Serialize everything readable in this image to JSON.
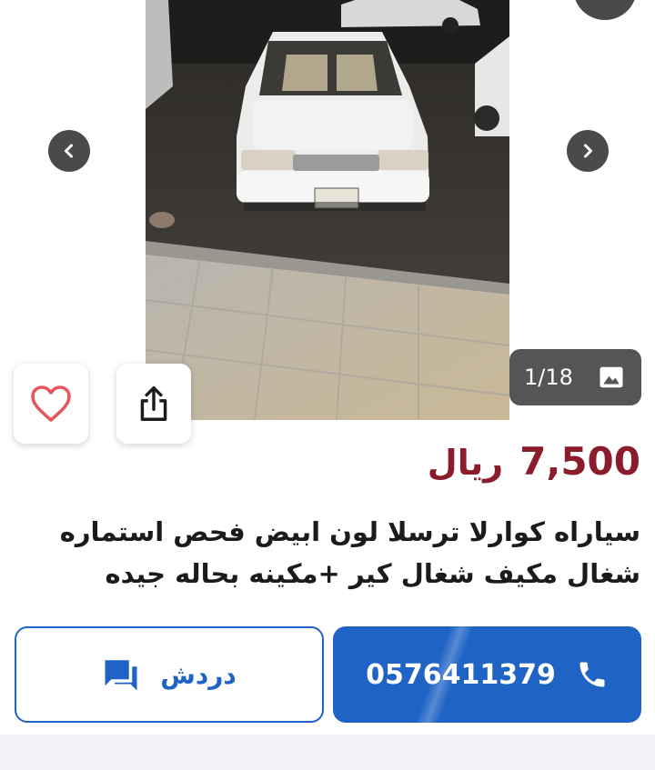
{
  "gallery": {
    "counter": "1/18",
    "photo_alt": "white sedan parked on dirt beside pavement"
  },
  "listing": {
    "price_value": "7,500",
    "price_currency": "ريال",
    "title_line1": "سياراه كوارلا ترسلا لون ابيض فحص استماره",
    "title_line2": "شغال مكيف شغال كير +مكينه بحاله جيده"
  },
  "actions": {
    "call_label": "0576411379",
    "chat_label": "دردش"
  },
  "colors": {
    "price": "#8a1c2b",
    "primary": "#1f64c5",
    "favorite": "#e4575f"
  }
}
